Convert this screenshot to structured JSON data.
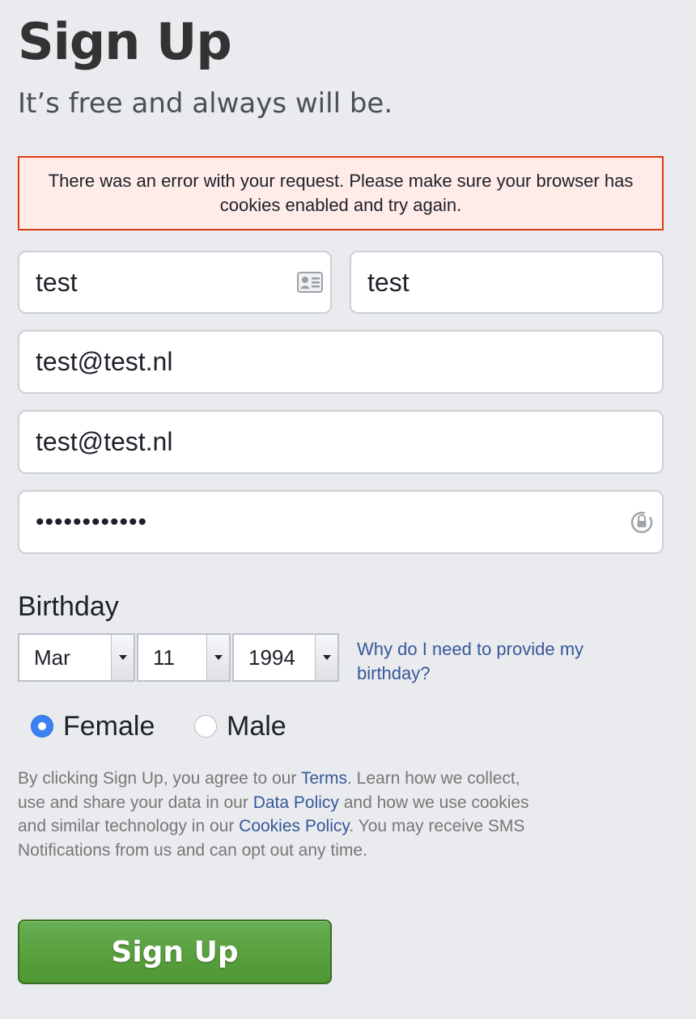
{
  "header": {
    "title": "Sign Up",
    "subtitle": "It’s free and always will be."
  },
  "error": {
    "message": "There was an error with your request. Please make sure your browser has cookies enabled and try again."
  },
  "form": {
    "first_name": "test",
    "last_name": "test",
    "email": "test@test.nl",
    "email_confirm": "test@test.nl",
    "password_masked": "••••••••••••",
    "first_name_icon": "contact-card-icon",
    "password_icon": "password-manager-icon"
  },
  "birthday": {
    "label": "Birthday",
    "month": "Mar",
    "day": "11",
    "year": "1994",
    "why_link": "Why do I need to provide my birthday?"
  },
  "gender": {
    "options": [
      {
        "label": "Female",
        "checked": true
      },
      {
        "label": "Male",
        "checked": false
      }
    ]
  },
  "terms": {
    "part1": "By clicking Sign Up, you agree to our ",
    "terms_link": "Terms",
    "part2": ". Learn how we collect, use and share your data in our ",
    "data_policy_link": "Data Policy",
    "part3": " and how we use cookies and similar technology in our ",
    "cookies_policy_link": "Cookies Policy",
    "part4": ". You may receive SMS Notifications from us and can opt out any time."
  },
  "submit": {
    "label": "Sign Up"
  },
  "colors": {
    "background": "#e9ebee",
    "error_border": "#dd3c10",
    "error_bg": "#ffebe8",
    "link": "#365899",
    "button_green": "#5aa140",
    "radio_selected": "#3b82f6"
  }
}
